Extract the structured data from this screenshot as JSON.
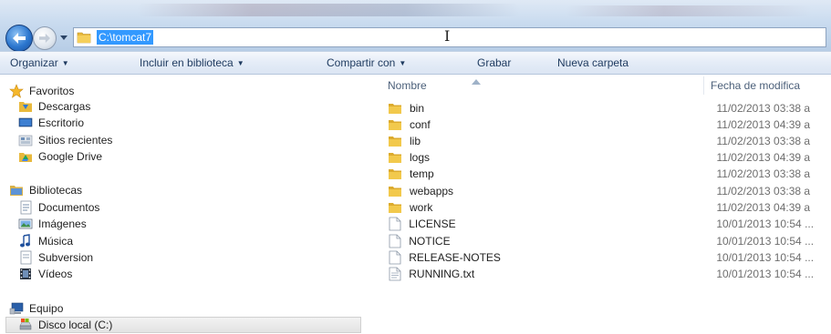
{
  "address": {
    "path": "C:\\tomcat7"
  },
  "toolbar": {
    "organize": "Organizar",
    "include_library": "Incluir en biblioteca",
    "share_with": "Compartir con",
    "burn": "Grabar",
    "new_folder": "Nueva carpeta"
  },
  "nav": {
    "favorites": {
      "label": "Favoritos",
      "items": [
        "Descargas",
        "Escritorio",
        "Sitios recientes",
        "Google Drive"
      ]
    },
    "libraries": {
      "label": "Bibliotecas",
      "items": [
        "Documentos",
        "Imágenes",
        "Música",
        "Subversion",
        "Vídeos"
      ]
    },
    "computer": {
      "label": "Equipo",
      "items": [
        "Disco local (C:)"
      ]
    }
  },
  "columns": {
    "name": "Nombre",
    "modified": "Fecha de modifica"
  },
  "files": [
    {
      "name": "bin",
      "type": "folder",
      "date": "11/02/2013 03:38 a"
    },
    {
      "name": "conf",
      "type": "folder",
      "date": "11/02/2013 04:39 a"
    },
    {
      "name": "lib",
      "type": "folder",
      "date": "11/02/2013 03:38 a"
    },
    {
      "name": "logs",
      "type": "folder",
      "date": "11/02/2013 04:39 a"
    },
    {
      "name": "temp",
      "type": "folder",
      "date": "11/02/2013 03:38 a"
    },
    {
      "name": "webapps",
      "type": "folder",
      "date": "11/02/2013 03:38 a"
    },
    {
      "name": "work",
      "type": "folder",
      "date": "11/02/2013 04:39 a"
    },
    {
      "name": "LICENSE",
      "type": "file",
      "date": "10/01/2013 10:54 ..."
    },
    {
      "name": "NOTICE",
      "type": "file",
      "date": "10/01/2013 10:54 ..."
    },
    {
      "name": "RELEASE-NOTES",
      "type": "file",
      "date": "10/01/2013 10:54 ..."
    },
    {
      "name": "RUNNING.txt",
      "type": "text-file",
      "date": "10/01/2013 10:54 ..."
    }
  ],
  "colors": {
    "address_highlight": "#3399ff",
    "folder": "#e8b93c",
    "toolbar_text": "#1e3a5f"
  }
}
